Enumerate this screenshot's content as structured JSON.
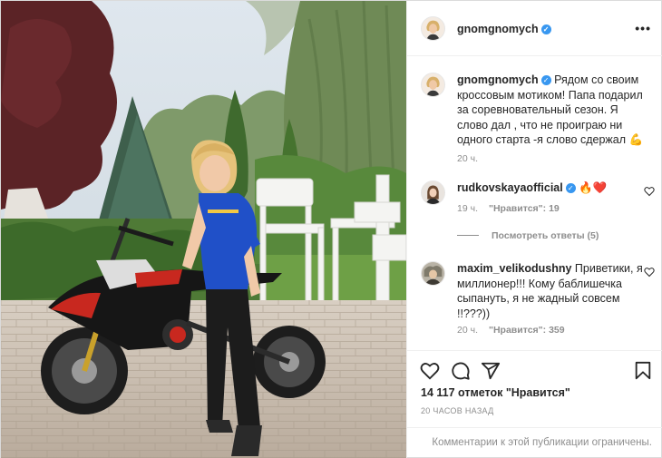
{
  "post": {
    "username": "gnomgnomych",
    "verified_mark": "✓",
    "more_icon": "•••"
  },
  "caption": {
    "username": "gnomgnomych",
    "text": " Рядом со своим кроссовым мотиком! Папа подарил за соревновательный сезон. Я слово дал , что не проиграю ни одного старта -я слово сдержал ",
    "emoji": "💪",
    "time": "20 ч."
  },
  "comments": [
    {
      "username": "rudkovskayaofficial",
      "text": " 🔥❤️",
      "time": "19 ч.",
      "likes": "\"Нравится\": 19"
    },
    {
      "username": "maxim_velikodushny",
      "text": " Приветики, я миллионер!!! Кому баблишечка сыпануть, я не жадный совсем !!???))",
      "time": "20 ч.",
      "likes": "\"Нравится\": 359"
    }
  ],
  "view_replies": "Посмотреть ответы (5)",
  "likes_text": "14 117 отметок \"Нравится\"",
  "timestamp": "20 ЧАСОВ НАЗАД",
  "comments_restricted": "Комментарии к этой публикации ограничены.",
  "icons": {
    "like": "heart-icon",
    "comment": "comment-icon",
    "share": "share-icon",
    "save": "bookmark-icon"
  },
  "colors": {
    "verified": "#3897f0",
    "secondary_text": "#8e8e8e",
    "border": "#dbdbdb"
  }
}
